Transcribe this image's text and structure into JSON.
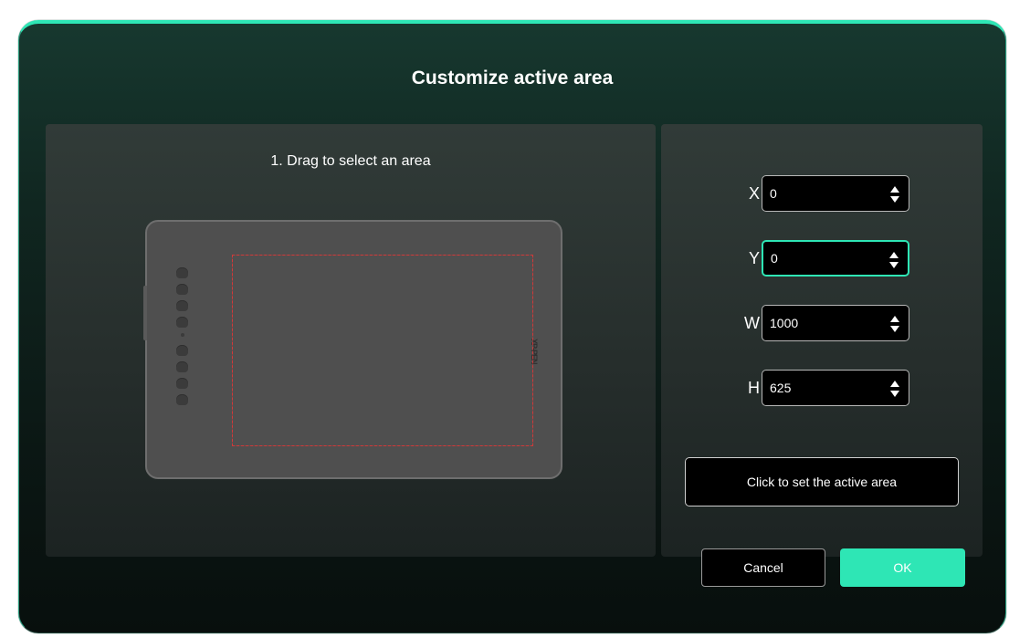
{
  "dialog": {
    "title": "Customize active area"
  },
  "area_selector": {
    "instruction": "1. Drag to select an area",
    "tablet_brand_text": "XP-PEN"
  },
  "fields": [
    {
      "label": "X",
      "value": "0"
    },
    {
      "label": "Y",
      "value": "0"
    },
    {
      "label": "W",
      "value": "1000"
    },
    {
      "label": "H",
      "value": "625"
    }
  ],
  "set_area_button": "Click to set the active area",
  "buttons": {
    "cancel": "Cancel",
    "ok": "OK"
  },
  "colors": {
    "accent": "#2ee6b5",
    "selection_border": "#d23a3a",
    "panel": "#2a3331"
  },
  "icons": {
    "spinner": "updown-arrows-icon"
  }
}
